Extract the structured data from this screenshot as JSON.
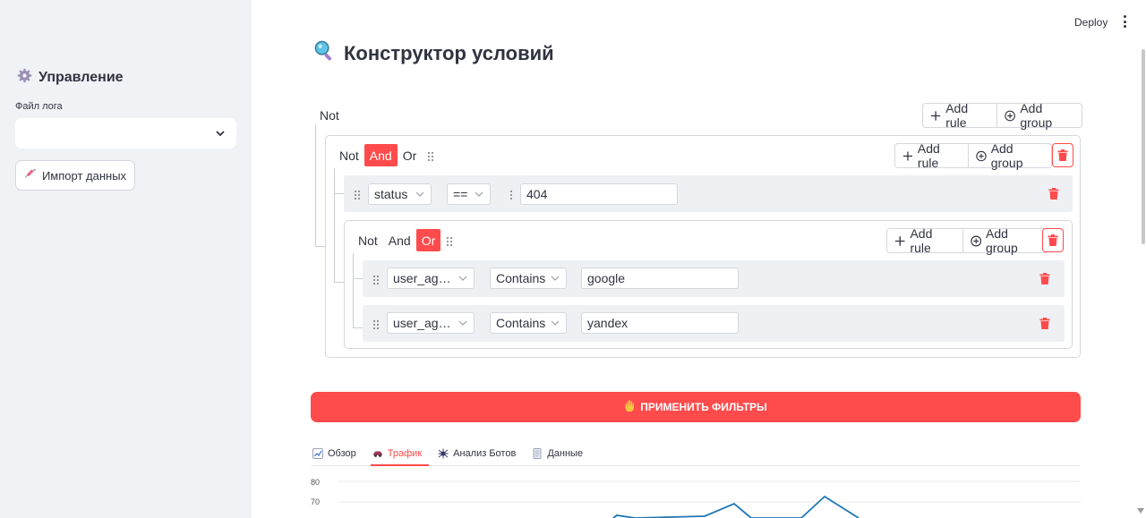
{
  "sidebar": {
    "title": "Управление",
    "file_label": "Файл лога",
    "file_value": "",
    "import_label": "Импорт данных"
  },
  "header": {
    "deploy": "Deploy"
  },
  "main": {
    "title": "Конструктор условий"
  },
  "query": {
    "root": {
      "not_label": "Not",
      "add_rule": "Add rule",
      "add_group": "Add group"
    },
    "group1": {
      "not": "Not",
      "and": "And",
      "or": "Or",
      "active": "And",
      "add_rule": "Add rule",
      "add_group": "Add group",
      "rule": {
        "field": "status",
        "operator": "==",
        "value": "404"
      }
    },
    "group2": {
      "not": "Not",
      "and": "And",
      "or": "Or",
      "active": "Or",
      "add_rule": "Add rule",
      "add_group": "Add group",
      "rules": [
        {
          "field": "user_ag…",
          "operator": "Contains",
          "value": "google"
        },
        {
          "field": "user_ag…",
          "operator": "Contains",
          "value": "yandex"
        }
      ]
    }
  },
  "apply_label": "ПРИМЕНИТЬ ФИЛЬТРЫ",
  "tabs": [
    {
      "label": "Обзор",
      "icon": "chart-icon",
      "active": false
    },
    {
      "label": "Трафик",
      "icon": "car-icon",
      "active": true
    },
    {
      "label": "Анализ Ботов",
      "icon": "bug-icon",
      "active": false
    },
    {
      "label": "Данные",
      "icon": "document-icon",
      "active": false
    }
  ],
  "chart_data": {
    "type": "line",
    "yticks": [
      "80",
      "70"
    ],
    "partial": true,
    "series_color": "#1f77b4"
  },
  "colors": {
    "accent": "#ff4b4b",
    "sidebar_bg": "#f0f2f6"
  }
}
